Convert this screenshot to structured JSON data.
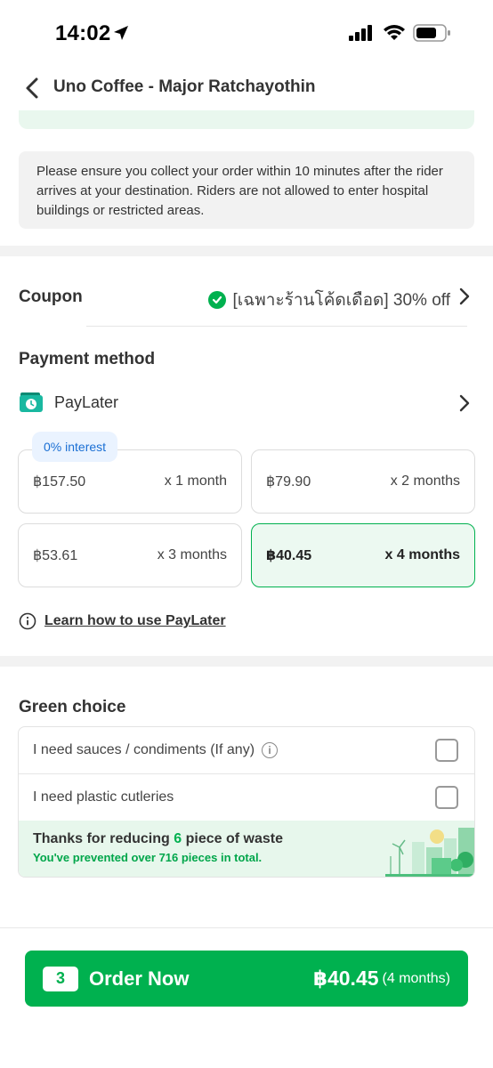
{
  "status": {
    "time": "14:02"
  },
  "header": {
    "title": "Uno Coffee - Major Ratchayothin"
  },
  "notice": {
    "text": "Please ensure you collect your order within 10 minutes after the rider arrives at your destination. Riders are not allowed to enter hospital buildings or restricted areas."
  },
  "coupon": {
    "label": "Coupon",
    "value": "[เฉพาะร้านโค้ดเดือด] 30% off"
  },
  "payment": {
    "label": "Payment method",
    "method": "PayLater",
    "interest_badge": "0% interest",
    "plans": [
      {
        "amount": "฿157.50",
        "term": "x 1 month"
      },
      {
        "amount": "฿79.90",
        "term": "x 2 months"
      },
      {
        "amount": "฿53.61",
        "term": "x 3 months"
      },
      {
        "amount": "฿40.45",
        "term": "x 4 months",
        "selected": true
      }
    ],
    "learn_link": "Learn how to use PayLater"
  },
  "green_choice": {
    "label": "Green choice",
    "options": [
      {
        "label": "I need sauces / condiments (If any)",
        "checked": false
      },
      {
        "label": "I need plastic cutleries",
        "checked": false
      }
    ],
    "banner": {
      "title_prefix": "Thanks for reducing ",
      "count": "6",
      "title_suffix": " piece of waste",
      "subtitle": "You've prevented over 716 pieces in total."
    }
  },
  "order": {
    "quantity": "3",
    "label": "Order Now",
    "price": "฿40.45",
    "months": "(4 months)"
  },
  "colors": {
    "accent": "#00b14f",
    "badge_blue": "#1a6fd4"
  }
}
